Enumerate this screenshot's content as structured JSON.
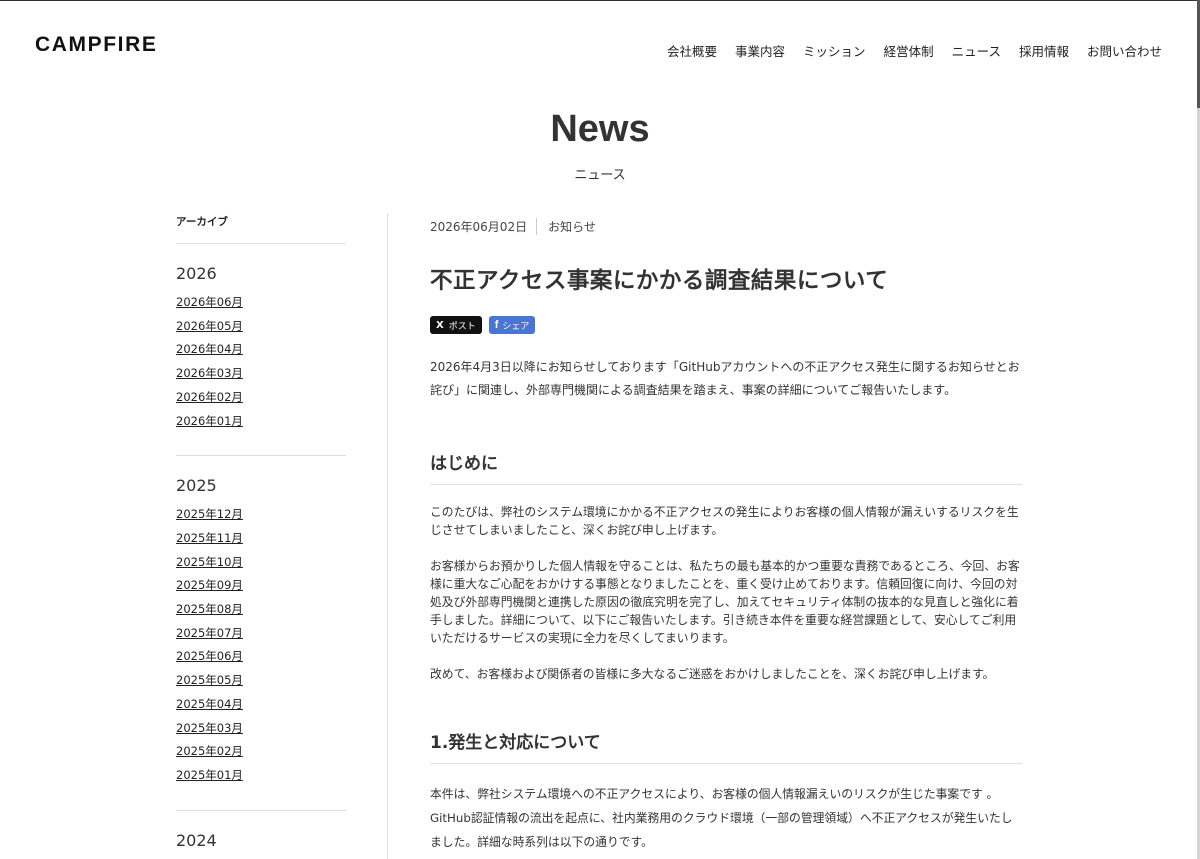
{
  "header": {
    "logo": "CAMPFIRE",
    "nav": [
      "会社概要",
      "事業内容",
      "ミッション",
      "経営体制",
      "ニュース",
      "採用情報",
      "お問い合わせ"
    ]
  },
  "page": {
    "title": "News",
    "subtitle": "ニュース"
  },
  "sidebar": {
    "heading": "アーカイブ",
    "years": [
      {
        "year": "2026",
        "months": [
          "2026年06月",
          "2026年05月",
          "2026年04月",
          "2026年03月",
          "2026年02月",
          "2026年01月"
        ]
      },
      {
        "year": "2025",
        "months": [
          "2025年12月",
          "2025年11月",
          "2025年10月",
          "2025年09月",
          "2025年08月",
          "2025年07月",
          "2025年06月",
          "2025年05月",
          "2025年04月",
          "2025年03月",
          "2025年02月",
          "2025年01月"
        ]
      },
      {
        "year": "2024",
        "months": []
      }
    ]
  },
  "article": {
    "date": "2026年06月02日",
    "category": "お知らせ",
    "title": "不正アクセス事案にかかる調査結果について",
    "share_x": "ポスト",
    "share_x_icon": "X",
    "share_fb": "シェア",
    "share_fb_icon": "f",
    "lead": "2026年4月3日以降にお知らせしております「GitHubアカウントへの不正アクセス発生に関するお知らせとお詫び」に関連し、外部専門機関による調査結果を踏まえ、事案の詳細についてご報告いたします。",
    "section1_title": "はじめに",
    "section1_p1": "このたびは、弊社のシステム環境にかかる不正アクセスの発生によりお客様の個人情報が漏えいするリスクを生じさせてしまいましたこと、深くお詫び申し上げます。",
    "section1_p2": "お客様からお預かりした個人情報を守ることは、私たちの最も基本的かつ重要な責務であるところ、今回、お客様に重大なご心配をおかけする事態となりましたことを、重く受け止めております。信頼回復に向け、今回の対処及び外部専門機関と連携した原因の徹底究明を完了し、加えてセキュリティ体制の抜本的な見直しと強化に着手しました。詳細について、以下にご報告いたします。引き続き本件を重要な経営課題として、安心してご利用いただけるサービスの実現に全力を尽くしてまいります。",
    "section1_p3": "改めて、お客様および関係者の皆様に多大なるご迷惑をおかけしましたことを、深くお詫び申し上げます。",
    "section2_title": "1.発生と対応について",
    "section2_p1": "本件は、弊社システム環境への不正アクセスにより、お客様の個人情報漏えいのリスクが生じた事案です 。GitHub認証情報の流出を起点に、社内業務用のクラウド環境（一部の管理領域）へ不正アクセスが発生いたしました。詳細な時系列は以下の通りです。"
  }
}
